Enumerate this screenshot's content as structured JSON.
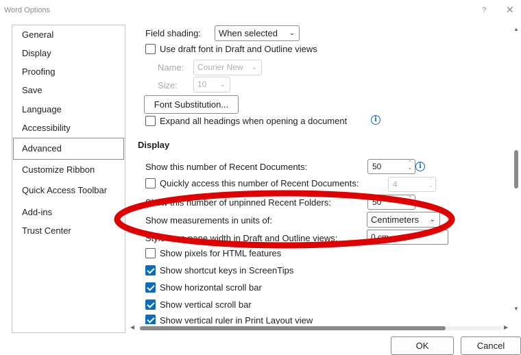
{
  "window": {
    "title": "Word Options",
    "help": "?",
    "close": "✕"
  },
  "sidebar": {
    "items": [
      {
        "label": "General"
      },
      {
        "label": "Display"
      },
      {
        "label": "Proofing"
      },
      {
        "label": "Save"
      },
      {
        "label": "Language"
      },
      {
        "label": "Accessibility"
      },
      {
        "label": "Advanced",
        "selected": true
      },
      {
        "label": "Customize Ribbon"
      },
      {
        "label": "Quick Access Toolbar"
      },
      {
        "label": "Add-ins"
      },
      {
        "label": "Trust Center"
      }
    ]
  },
  "content": {
    "field_shading": {
      "label": "Field shading:",
      "value": "When selected"
    },
    "draft_font": {
      "label": "Use draft font in Draft and Outline views",
      "checked": false
    },
    "name": {
      "label": "Name:",
      "value": "Courier New"
    },
    "size": {
      "label": "Size:",
      "value": "10"
    },
    "font_substitution_button": "Font Substitution...",
    "expand_headings": {
      "label": "Expand all headings when opening a document",
      "checked": false
    },
    "display_header": "Display",
    "recent_documents": {
      "label": "Show this number of Recent Documents:",
      "value": "50"
    },
    "quick_access_recent": {
      "label": "Quickly access this number of Recent Documents:",
      "value": "4",
      "checked": false
    },
    "unpinned_folders": {
      "label": "Show this number of unpinned Recent Folders:",
      "value": "50"
    },
    "measurement_units": {
      "label": "Show measurements in units of:",
      "value": "Centimeters"
    },
    "style_area": {
      "label": "Style area pane width in Draft and Outline views:",
      "value": "0 cm"
    },
    "pixels_html": {
      "label": "Show pixels for HTML features",
      "checked": false
    },
    "shortcut_keys": {
      "label": "Show shortcut keys in ScreenTips",
      "checked": true
    },
    "horizontal_scroll": {
      "label": "Show horizontal scroll bar",
      "checked": true
    },
    "vertical_scroll": {
      "label": "Show vertical scroll bar",
      "checked": true
    },
    "vertical_ruler": {
      "label": "Show vertical ruler in Print Layout view",
      "checked": true
    }
  },
  "footer": {
    "ok_label": "OK",
    "cancel_label": "Cancel"
  },
  "colors": {
    "accent": "#0f6cbd",
    "annotation": "#e00000"
  }
}
